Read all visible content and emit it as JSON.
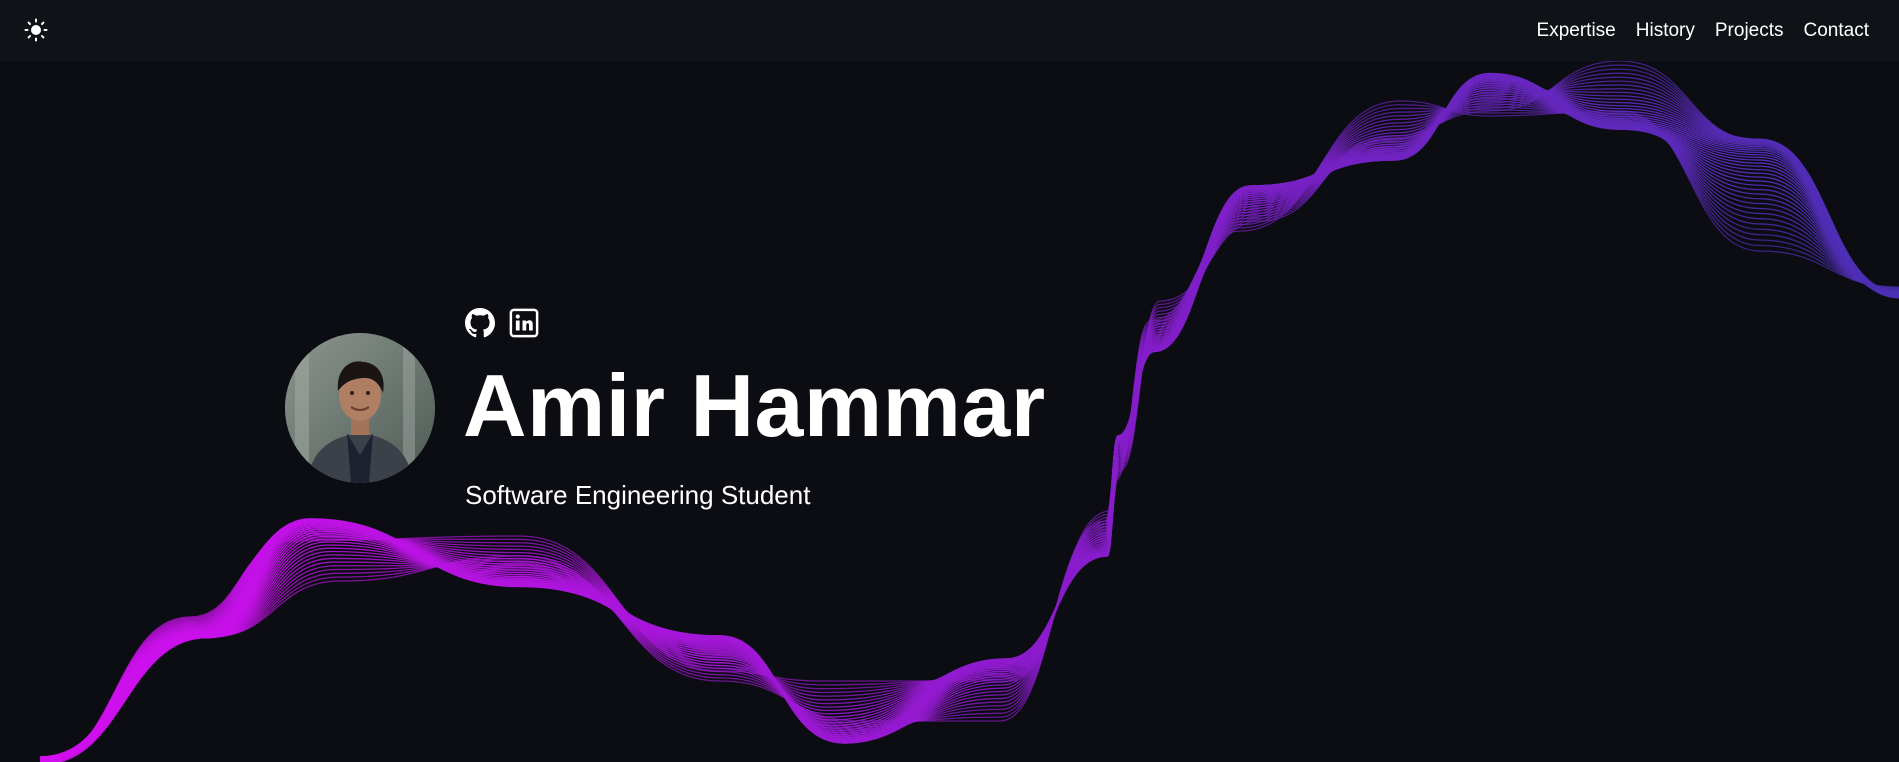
{
  "header": {
    "theme_toggle_icon": "sun-icon",
    "nav": [
      {
        "label": "Expertise"
      },
      {
        "label": "History"
      },
      {
        "label": "Projects"
      },
      {
        "label": "Contact"
      }
    ]
  },
  "hero": {
    "name": "Amir Hammar",
    "subtitle": "Software Engineering Student",
    "avatar_icon": "profile-photo",
    "socials": [
      {
        "icon": "github-icon"
      },
      {
        "icon": "linkedin-icon"
      }
    ]
  },
  "colors": {
    "background": "#0b0d12",
    "navbar": "#0f1216",
    "text": "#ffffff",
    "wave_start": "#d40ef0",
    "wave_mid": "#8a1bcc",
    "wave_end": "#4a2fb4"
  }
}
